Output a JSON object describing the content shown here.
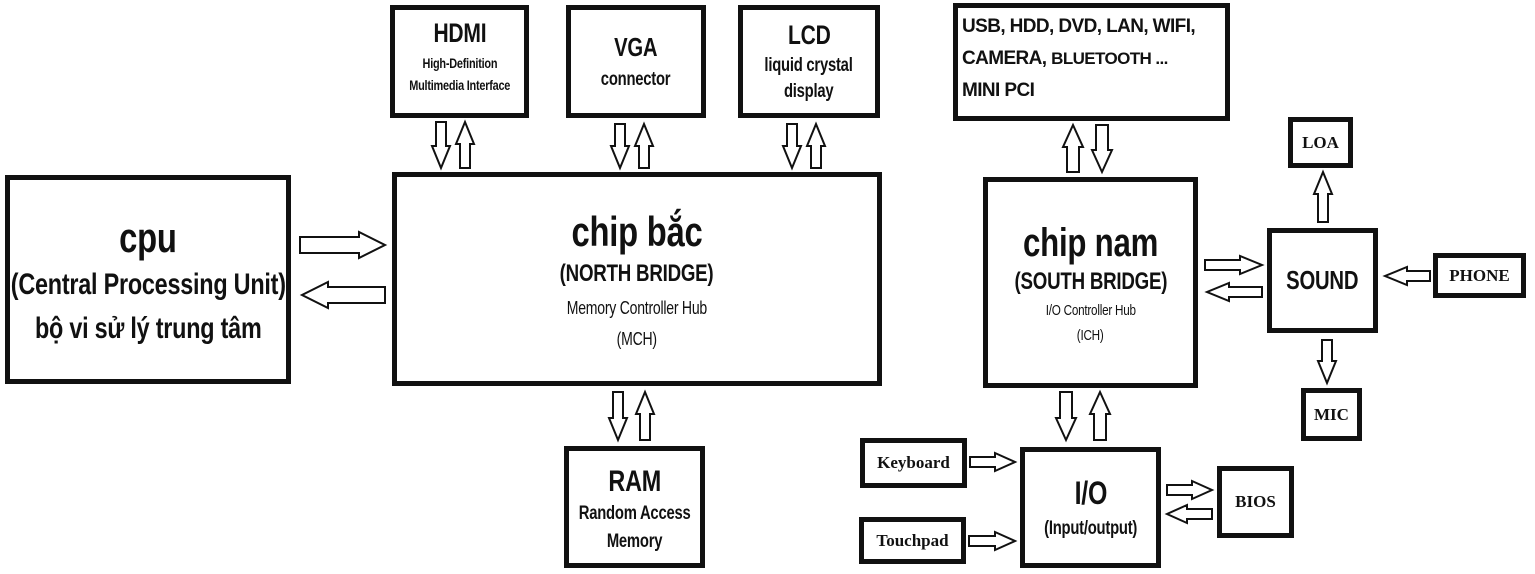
{
  "cpu": {
    "title": "cpu",
    "line1": "(Central Processing Unit)",
    "line2": "bộ vi sử lý trung tâm"
  },
  "north_bridge": {
    "title": "chip bắc",
    "subtitle": "(NORTH BRIDGE)",
    "line1": "Memory Controller Hub",
    "line2": "(MCH)"
  },
  "hdmi": {
    "title": "HDMI",
    "line1": "High-Definition",
    "line2": "Multimedia Interface"
  },
  "vga": {
    "title": "VGA",
    "line1": "connector"
  },
  "lcd": {
    "title": "LCD",
    "line1": "liquid crystal",
    "line2": "display"
  },
  "ram": {
    "title": "RAM",
    "line1": "Random Access",
    "line2": "Memory"
  },
  "peripherals": {
    "line1": "USB, HDD, DVD, LAN, WIFI,",
    "line2a": "CAMERA,",
    "line2b": "BLUETOOTH ...",
    "line3": "MINI PCI"
  },
  "south_bridge": {
    "title": "chip nam",
    "subtitle": "(SOUTH BRIDGE)",
    "line1": "I/O Controller Hub",
    "line2": "(ICH)"
  },
  "sound": {
    "title": "SOUND"
  },
  "loa": {
    "title": "LOA"
  },
  "phone": {
    "title": "PHONE"
  },
  "mic": {
    "title": "MIC"
  },
  "io": {
    "title": "I/O",
    "line1": "(Input/output)"
  },
  "keyboard": {
    "title": "Keyboard"
  },
  "touchpad": {
    "title": "Touchpad"
  },
  "bios": {
    "title": "BIOS"
  },
  "connections": [
    {
      "from": "hdmi",
      "to": "north_bridge"
    },
    {
      "from": "north_bridge",
      "to": "hdmi"
    },
    {
      "from": "vga",
      "to": "north_bridge"
    },
    {
      "from": "north_bridge",
      "to": "vga"
    },
    {
      "from": "lcd",
      "to": "north_bridge"
    },
    {
      "from": "north_bridge",
      "to": "lcd"
    },
    {
      "from": "cpu",
      "to": "north_bridge"
    },
    {
      "from": "north_bridge",
      "to": "cpu"
    },
    {
      "from": "north_bridge",
      "to": "ram"
    },
    {
      "from": "ram",
      "to": "north_bridge"
    },
    {
      "from": "south_bridge",
      "to": "peripherals"
    },
    {
      "from": "peripherals",
      "to": "south_bridge"
    },
    {
      "from": "south_bridge",
      "to": "sound"
    },
    {
      "from": "sound",
      "to": "south_bridge"
    },
    {
      "from": "sound",
      "to": "loa"
    },
    {
      "from": "phone",
      "to": "sound"
    },
    {
      "from": "sound",
      "to": "mic"
    },
    {
      "from": "south_bridge",
      "to": "io"
    },
    {
      "from": "io",
      "to": "south_bridge"
    },
    {
      "from": "keyboard",
      "to": "io"
    },
    {
      "from": "touchpad",
      "to": "io"
    },
    {
      "from": "io",
      "to": "bios"
    },
    {
      "from": "bios",
      "to": "io"
    }
  ]
}
